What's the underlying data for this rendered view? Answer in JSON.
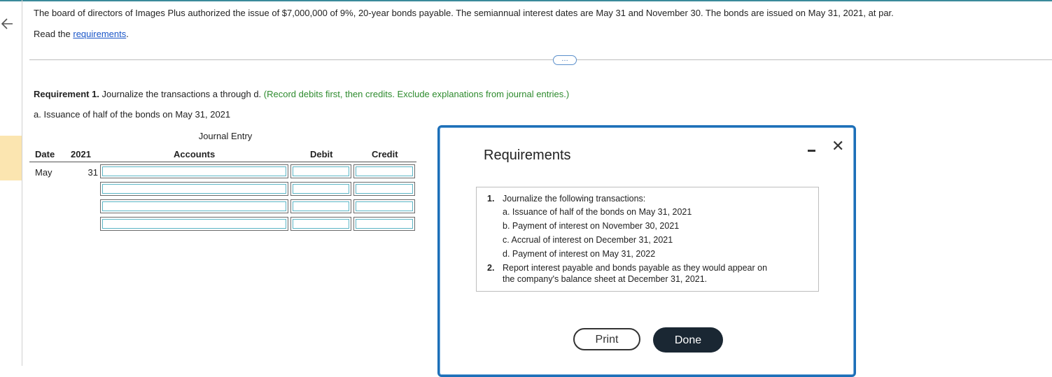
{
  "problem": {
    "text": "The board of directors of Images Plus authorized the issue of $7,000,000 of 9%, 20-year bonds payable. The semiannual interest dates are May 31 and November 30. The bonds are issued on May 31, 2021, at par.",
    "read_prefix": "Read the ",
    "read_link": "requirements",
    "read_suffix": "."
  },
  "more_button": "…",
  "requirement": {
    "label": "Requirement 1.",
    "text": " Journalize the transactions a through d. ",
    "hint": "(Record debits first, then credits. Exclude explanations from journal entries.)",
    "subpart": "a. Issuance of half of the bonds on May 31, 2021"
  },
  "journal": {
    "title": "Journal Entry",
    "headers": {
      "date": "Date",
      "year": "2021",
      "accounts": "Accounts",
      "debit": "Debit",
      "credit": "Credit"
    },
    "month": "May",
    "day": "31"
  },
  "modal": {
    "title": "Requirements",
    "items": [
      {
        "num": "1.",
        "text": "Journalize the following transactions:"
      },
      {
        "num": "",
        "text": "a. Issuance of half of the bonds on May 31, 2021"
      },
      {
        "num": "",
        "text": "b. Payment of interest on November 30, 2021"
      },
      {
        "num": "",
        "text": "c. Accrual of interest on December 31, 2021"
      },
      {
        "num": "",
        "text": "d. Payment of interest on May 31, 2022"
      },
      {
        "num": "2.",
        "text": "Report interest payable and bonds payable as they would appear on"
      },
      {
        "num": "",
        "text": "the company's balance sheet at December 31, 2021."
      }
    ],
    "print_label": "Print",
    "done_label": "Done",
    "close_glyph": "✕"
  },
  "colors": {
    "accent": "#1c6fb8",
    "hint_green": "#2e8b2e",
    "link_blue": "#1a56c8",
    "done_bg": "#1a2733"
  }
}
